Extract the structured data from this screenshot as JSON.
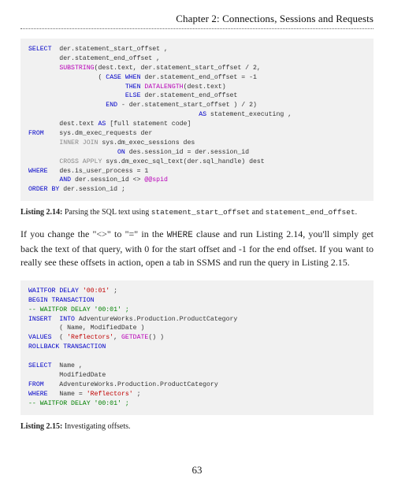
{
  "header": {
    "chapter_title": "Chapter 2: Connections, Sessions and Requests"
  },
  "code1": {
    "raw": "SELECT  der.statement_start_offset ,\n        der.statement_end_offset ,\n        SUBSTRING(dest.text, der.statement_start_offset / 2,\n                  ( CASE WHEN der.statement_end_offset = -1\n                         THEN DATALENGTH(dest.text)\n                         ELSE der.statement_end_offset\n                    END - der.statement_start_offset ) / 2)\n                                            AS statement_executing ,\n        dest.text AS [full statement code]\nFROM    sys.dm_exec_requests der\n        INNER JOIN sys.dm_exec_sessions des\n                       ON des.session_id = der.session_id\n        CROSS APPLY sys.dm_exec_sql_text(der.sql_handle) dest\nWHERE   des.is_user_process = 1\n        AND der.session_id <> @@spid\nORDER BY der.session_id ;"
  },
  "caption1": {
    "label": "Listing 2.14:",
    "text_a": "Parsing the SQL text using ",
    "code_a": "statement_start_offset",
    "text_b": " and ",
    "code_b": "statement_end_offset",
    "text_c": "."
  },
  "paragraph1": {
    "t1": "If you change the \"<>\" to \"=\" in the ",
    "c1": "WHERE",
    "t2": " clause and run Listing 2.14, you'll simply get back the text of that query, with 0 for the start offset and -1 for the end offset. If you want to really see these offsets in action, open a tab in SSMS and run the query in Listing 2.15."
  },
  "code2": {
    "raw": "WAITFOR DELAY '00:01' ;\nBEGIN TRANSACTION\n-- WAITFOR DELAY '00:01' ;\nINSERT  INTO AdventureWorks.Production.ProductCategory\n        ( Name, ModifiedDate )\nVALUES  ( 'Reflectors', GETDATE() )\nROLLBACK TRANSACTION\n\nSELECT  Name ,\n        ModifiedDate\nFROM    AdventureWorks.Production.ProductCategory\nWHERE   Name = 'Reflectors' ;\n-- WAITFOR DELAY '00:01' ;"
  },
  "caption2": {
    "label": "Listing 2.15:",
    "text": "Investigating offsets."
  },
  "page_number": "63",
  "chart_data": null
}
